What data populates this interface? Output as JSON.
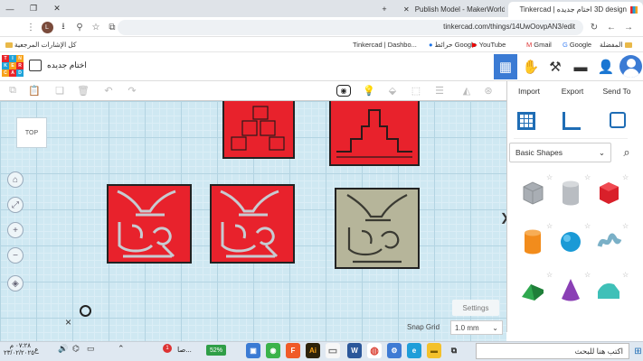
{
  "browser": {
    "tabs": [
      {
        "label": "Publish Model - MakerWorld"
      },
      {
        "label": "3D design اختام جديده | Tinkercad"
      }
    ],
    "new_tab": "+",
    "url": "tinkercad.com/things/14UwOovpAN3/edit",
    "profile_letter": "L"
  },
  "bookmarks": [
    {
      "label": "Tinkercad | Dashbo..."
    },
    {
      "label": "حرائط Google"
    },
    {
      "label": "YouTube"
    },
    {
      "label": "Gmail"
    },
    {
      "label": "Google"
    },
    {
      "label": "المفضلة"
    },
    {
      "label": "كل الإشارات المرجعية"
    }
  ],
  "app": {
    "logo": [
      "TIN",
      "KER",
      "CAD"
    ],
    "design_title": "اختام جديده",
    "view_cube": "TOP",
    "panel_buttons": [
      "Import",
      "Export",
      "Send To"
    ],
    "shape_category": "Basic Shapes",
    "settings": "Settings",
    "snap_grid_label": "Snap Grid",
    "snap_grid_value": "1.0 mm",
    "collapse_glyph": "❯",
    "close_glyph": "×"
  },
  "shapes": [
    {
      "name": "box-hole",
      "color": "#a9aeb4"
    },
    {
      "name": "cylinder-hole",
      "color": "#b9bdc2"
    },
    {
      "name": "box",
      "color": "#d9202a"
    },
    {
      "name": "cylinder",
      "color": "#f28c1c"
    },
    {
      "name": "sphere",
      "color": "#1a9ad6"
    },
    {
      "name": "scribble",
      "color": "#7ab0c7"
    },
    {
      "name": "roof",
      "color": "#2fa84f"
    },
    {
      "name": "cone",
      "color": "#8a3fb5"
    },
    {
      "name": "round-roof",
      "color": "#3fc0b8"
    }
  ],
  "taskbar": {
    "time": "٠٧:٢٨ م",
    "date": "٢٣/٠٢/٢٠٢٥",
    "battery": "52%",
    "search_placeholder": "اكتب هنا للبحث",
    "lang": "ع",
    "weather_short": "صا...",
    "badge": "1"
  }
}
